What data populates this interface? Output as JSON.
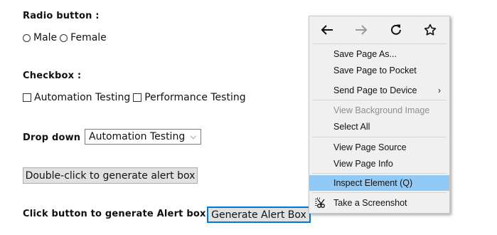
{
  "form": {
    "radio_label": "Radio button :",
    "radio_options": [
      "Male",
      "Female"
    ],
    "checkbox_label": "Checkbox :",
    "checkbox_options": [
      "Automation Testing",
      "Performance Testing"
    ],
    "dropdown_label": "Drop down :",
    "dropdown_value": "Automation Testing",
    "double_click_button": "Double-click to generate alert box",
    "alert_label": "Click button to generate Alert box :",
    "alert_button": "Generate Alert Box"
  },
  "context_menu": {
    "nav": {
      "back_icon": "arrow-left-icon",
      "forward_icon": "arrow-right-icon",
      "reload_icon": "reload-icon",
      "bookmark_icon": "star-icon"
    },
    "items": [
      {
        "label": "Save Page As...",
        "disabled": false
      },
      {
        "label": "Save Page to Pocket",
        "disabled": false
      },
      {
        "label": "Send Page to Device",
        "disabled": false,
        "submenu": true
      },
      {
        "label": "View Background Image",
        "disabled": true
      },
      {
        "label": "Select All",
        "disabled": false
      },
      {
        "label": "View Page Source",
        "disabled": false
      },
      {
        "label": "View Page Info",
        "disabled": false
      },
      {
        "label": "Inspect Element (Q)",
        "disabled": false,
        "highlighted": true
      },
      {
        "label": "Take a Screenshot",
        "disabled": false,
        "icon": "screenshot-scissors-icon"
      }
    ]
  },
  "colors": {
    "highlight": "#91c9f7",
    "menu_bg": "#f0f0f0",
    "focus_border": "#0078d7"
  }
}
